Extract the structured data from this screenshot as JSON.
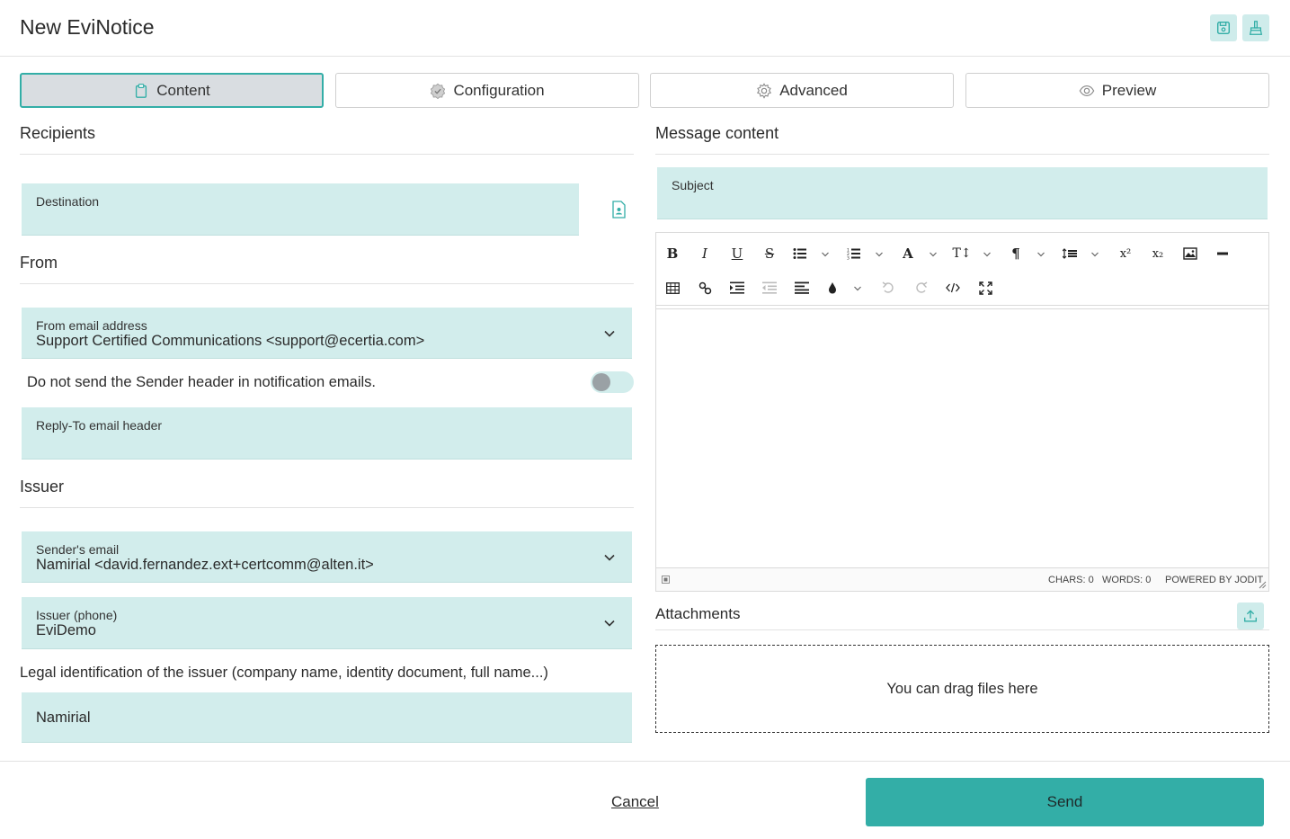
{
  "header": {
    "title": "New EviNotice",
    "save_icon": "save-icon",
    "clear_icon": "broom-icon",
    "accent_bg": "#cfeceb",
    "accent_fg": "#33aea7"
  },
  "tabs": [
    {
      "label": "Content",
      "icon": "clipboard-icon",
      "active": true
    },
    {
      "label": "Configuration",
      "icon": "badge-check-icon",
      "active": false
    },
    {
      "label": "Advanced",
      "icon": "gear-icon",
      "active": false
    },
    {
      "label": "Preview",
      "icon": "eye-icon",
      "active": false
    }
  ],
  "recipients": {
    "title": "Recipients",
    "destination_label": "Destination",
    "destination_value": "",
    "contact_icon": "contact-book-icon"
  },
  "from": {
    "title": "From",
    "email_label": "From email address",
    "email_value": "Support Certified Communications <support@ecertia.com>",
    "sender_header_text": "Do not send the Sender header in notification emails.",
    "sender_header_toggle": false,
    "reply_to_label": "Reply-To email header",
    "reply_to_value": ""
  },
  "issuer": {
    "title": "Issuer",
    "sender_email_label": "Sender's email",
    "sender_email_value": "Namirial <david.fernandez.ext+certcomm@alten.it>",
    "phone_label": "Issuer (phone)",
    "phone_value": "EviDemo",
    "legal_id_label": "Legal identification of the issuer (company name, identity document, full name...)",
    "legal_id_value": "Namirial"
  },
  "message": {
    "title": "Message content",
    "subject_label": "Subject",
    "subject_value": "",
    "statusbar": {
      "chars": "CHARS: 0",
      "words": "WORDS: 0",
      "powered": "POWERED BY JODIT"
    }
  },
  "attachments": {
    "title": "Attachments",
    "upload_icon": "upload-icon",
    "dropzone_text": "You can drag files here"
  },
  "footer": {
    "cancel_label": "Cancel",
    "send_label": "Send",
    "send_color": "#33aea7"
  }
}
